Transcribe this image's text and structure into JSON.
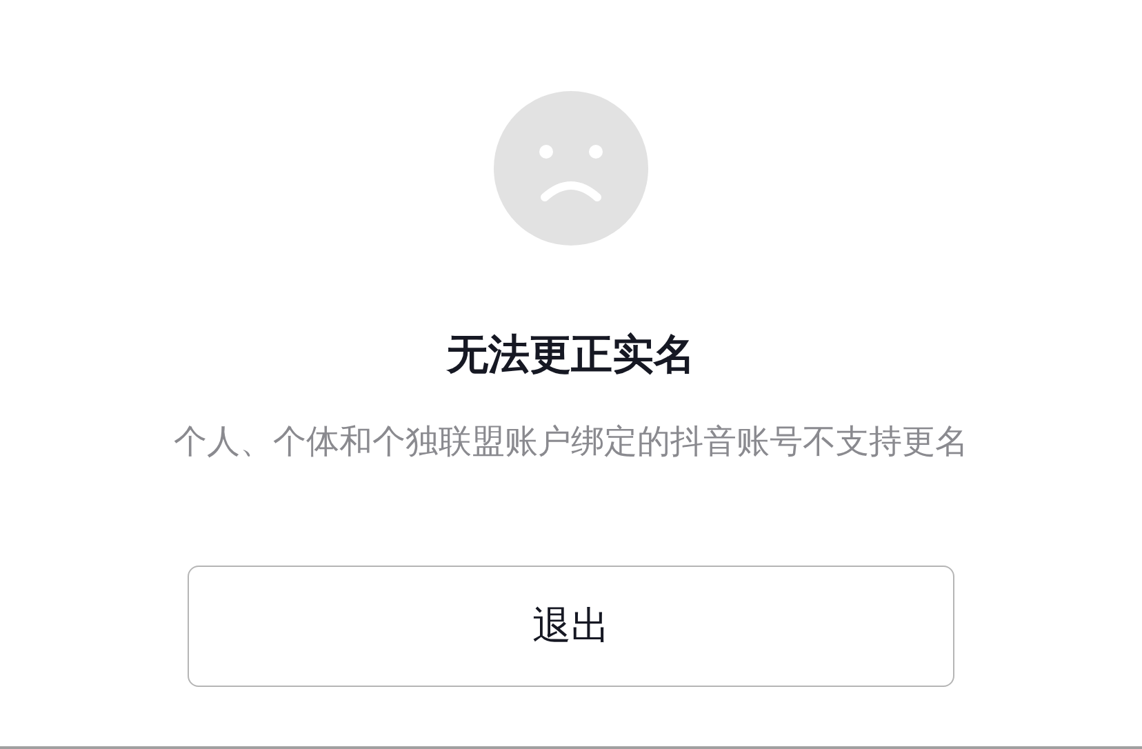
{
  "dialog": {
    "title": "无法更正实名",
    "message": "个人、个体和个独联盟账户绑定的抖音账号不支持更名",
    "buttons": [
      {
        "label": "退出"
      }
    ]
  }
}
